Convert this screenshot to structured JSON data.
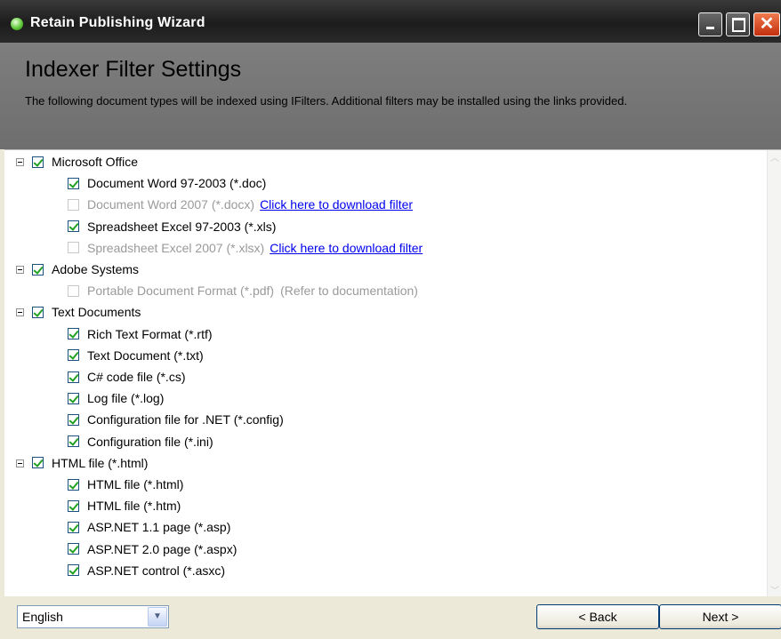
{
  "window": {
    "title": "Retain Publishing Wizard",
    "controls": {
      "minimize": "minimize-icon",
      "maximize": "maximize-icon",
      "close": "close-icon"
    }
  },
  "header": {
    "heading": "Indexer Filter Settings",
    "description": "The following document types will be indexed using IFilters. Additional filters may be installed using the links provided."
  },
  "groups": [
    {
      "label": "Microsoft Office",
      "checked": true,
      "items": [
        {
          "label": "Document Word 97-2003 (*.doc)",
          "checked": true,
          "disabled": false
        },
        {
          "label": "Document Word 2007 (*.docx)",
          "checked": false,
          "disabled": true,
          "link": "Click here to download filter"
        },
        {
          "label": "Spreadsheet Excel 97-2003 (*.xls)",
          "checked": true,
          "disabled": false
        },
        {
          "label": "Spreadsheet Excel 2007 (*.xlsx)",
          "checked": false,
          "disabled": true,
          "link": "Click here to download filter"
        }
      ]
    },
    {
      "label": "Adobe Systems",
      "checked": true,
      "items": [
        {
          "label": "Portable Document Format (*.pdf)",
          "checked": false,
          "disabled": true,
          "note": "(Refer to documentation)"
        }
      ]
    },
    {
      "label": "Text Documents",
      "checked": true,
      "items": [
        {
          "label": "Rich Text Format (*.rtf)",
          "checked": true,
          "disabled": false
        },
        {
          "label": "Text Document (*.txt)",
          "checked": true,
          "disabled": false
        },
        {
          "label": "C# code file (*.cs)",
          "checked": true,
          "disabled": false
        },
        {
          "label": "Log file (*.log)",
          "checked": true,
          "disabled": false
        },
        {
          "label": "Configuration file for .NET (*.config)",
          "checked": true,
          "disabled": false
        },
        {
          "label": "Configuration file (*.ini)",
          "checked": true,
          "disabled": false
        }
      ]
    },
    {
      "label": "HTML file (*.html)",
      "checked": true,
      "items": [
        {
          "label": "HTML file (*.html)",
          "checked": true,
          "disabled": false
        },
        {
          "label": "HTML file (*.htm)",
          "checked": true,
          "disabled": false
        },
        {
          "label": "ASP.NET 1.1 page (*.asp)",
          "checked": true,
          "disabled": false
        },
        {
          "label": "ASP.NET 2.0 page (*.aspx)",
          "checked": true,
          "disabled": false
        },
        {
          "label": "ASP.NET control (*.asxc)",
          "checked": true,
          "disabled": false
        }
      ]
    }
  ],
  "footer": {
    "language": "English",
    "back_label": "< Back",
    "next_label": "Next >"
  },
  "colors": {
    "titlebar": "#2a2a2a",
    "header": "#767676",
    "link": "#0000ee",
    "check": "#21a121"
  }
}
